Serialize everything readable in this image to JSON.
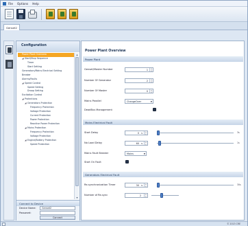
{
  "menu": [
    "File",
    "Options",
    "Help"
  ],
  "tab": {
    "label": "Genset2"
  },
  "nav": {
    "title": "Configuration",
    "items": [
      {
        "label": "Power Plant Overview",
        "indent": 1,
        "arrow": "",
        "selected": true
      },
      {
        "label": "Start/Stop Sequence",
        "indent": 1,
        "arrow": "◢",
        "selected": false
      },
      {
        "label": "Timer",
        "indent": 3,
        "arrow": "",
        "selected": false
      },
      {
        "label": "Start Setting",
        "indent": 3,
        "arrow": "",
        "selected": false
      },
      {
        "label": "Generators/Mains Electrical Setting",
        "indent": 1,
        "arrow": "",
        "selected": false
      },
      {
        "label": "Breaker",
        "indent": 1,
        "arrow": "",
        "selected": false
      },
      {
        "label": "Alarms/Faults",
        "indent": 1,
        "arrow": "",
        "selected": false
      },
      {
        "label": "Speed Control",
        "indent": 1,
        "arrow": "◢",
        "selected": false
      },
      {
        "label": "Speed Setting",
        "indent": 3,
        "arrow": "",
        "selected": false
      },
      {
        "label": "Droop Setting",
        "indent": 3,
        "arrow": "",
        "selected": false
      },
      {
        "label": "Excitation Control",
        "indent": 1,
        "arrow": "",
        "selected": false
      },
      {
        "label": "Protections",
        "indent": 1,
        "arrow": "◢",
        "selected": false
      },
      {
        "label": "Generators Protection",
        "indent": 2,
        "arrow": "◢",
        "selected": false
      },
      {
        "label": "Frequency Protection",
        "indent": 4,
        "arrow": "",
        "selected": false
      },
      {
        "label": "Voltage Protection",
        "indent": 4,
        "arrow": "",
        "selected": false
      },
      {
        "label": "Current Protection",
        "indent": 4,
        "arrow": "",
        "selected": false
      },
      {
        "label": "Power Protection",
        "indent": 4,
        "arrow": "",
        "selected": false
      },
      {
        "label": "Reactive Power Protection",
        "indent": 4,
        "arrow": "",
        "selected": false
      },
      {
        "label": "Mains Protection",
        "indent": 2,
        "arrow": "◢",
        "selected": false
      },
      {
        "label": "Frequency Protection",
        "indent": 4,
        "arrow": "",
        "selected": false
      },
      {
        "label": "Voltage Protection",
        "indent": 4,
        "arrow": "",
        "selected": false
      },
      {
        "label": "Engine/Battery Protection",
        "indent": 2,
        "arrow": "◢",
        "selected": false
      },
      {
        "label": "Speed Protection",
        "indent": 4,
        "arrow": "",
        "selected": false
      }
    ]
  },
  "connect": {
    "title": "Connect to Device",
    "device_label": "Device Name:",
    "device_value": "Genset2",
    "password_label": "Password:",
    "password_value": "",
    "button": "Connect"
  },
  "main": {
    "title": "Power Plant Overview",
    "power_plant": {
      "header": "Power Plant",
      "genset_number_label": "Genset/Master Number",
      "genset_number": "1",
      "num_generator_label": "Number Of Generator",
      "num_generator": "2",
      "num_master_label": "Number Of Master",
      "num_master": "0",
      "mains_parallel_label": "Mains Parallel",
      "mains_parallel": "ChangeOver",
      "deadbus_label": "DeadBus Management",
      "deadbus_checked": true
    },
    "mains_fault": {
      "header": "Mains Electrical Fault",
      "start_delay_label": "Start Delay",
      "start_delay": "0",
      "start_delay_unit": "s",
      "start_delay_fraction": 0.0,
      "start_delay_max_label": "3s",
      "no_load_delay_label": "No Load Delay",
      "no_load_delay": "60",
      "no_load_delay_unit": "s",
      "no_load_delay_fraction": 0.02,
      "no_load_delay_max_label": "1s",
      "breaker_label": "Mains Fault Breaker",
      "breaker_value": "Mains",
      "start_on_fault_label": "Start On Fault",
      "start_on_fault_checked": true
    },
    "gens_fault": {
      "header": "Generators Electrical Fault",
      "resync_label": "Re-synchronization Timer",
      "resync": "30",
      "resync_unit": "s",
      "resync_fraction": 0.0,
      "resync_max_label": "30s",
      "retries_label": "Number of Re-sync",
      "retries": "2",
      "retries_fraction": 0.35
    }
  },
  "status": {
    "text": "© 2013 CRE"
  }
}
